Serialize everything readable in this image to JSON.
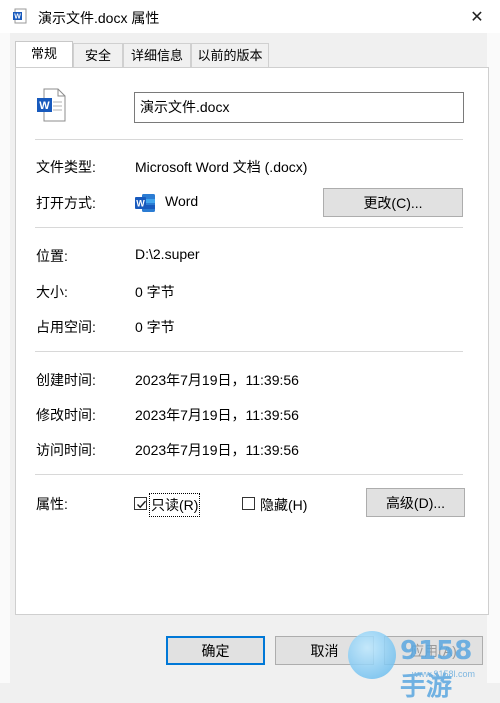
{
  "window": {
    "title": "演示文件.docx 属性",
    "close_glyph": "✕"
  },
  "tabs": [
    {
      "label": "常规",
      "active": true
    },
    {
      "label": "安全",
      "active": false
    },
    {
      "label": "详细信息",
      "active": false
    },
    {
      "label": "以前的版本",
      "active": false
    }
  ],
  "general": {
    "file_name": "演示文件.docx",
    "file_type_label": "文件类型:",
    "file_type_value": "Microsoft Word 文档 (.docx)",
    "open_with_label": "打开方式:",
    "open_with_value": "Word",
    "change_button": "更改(C)...",
    "location_label": "位置:",
    "location_value": "D:\\2.super",
    "size_label": "大小:",
    "size_value": "0 字节",
    "size_on_disk_label": "占用空间:",
    "size_on_disk_value": "0 字节",
    "created_label": "创建时间:",
    "created_value": "2023年7月19日，11:39:56",
    "modified_label": "修改时间:",
    "modified_value": "2023年7月19日，11:39:56",
    "accessed_label": "访问时间:",
    "accessed_value": "2023年7月19日，11:39:56",
    "attributes_label": "属性:",
    "readonly_label": "只读(R)",
    "readonly_checked": true,
    "hidden_label": "隐藏(H)",
    "hidden_checked": false,
    "advanced_button": "高级(D)..."
  },
  "footer": {
    "ok": "确定",
    "cancel": "取消",
    "apply": "应用(A)"
  },
  "watermark": {
    "brand": "9158手游",
    "url": "www.9158l.com"
  },
  "colors": {
    "word_blue": "#185abd",
    "accent": "#0078d7"
  },
  "icons": {
    "title": "word-doc-icon",
    "file": "word-doc-icon",
    "open_with": "word-app-icon"
  }
}
